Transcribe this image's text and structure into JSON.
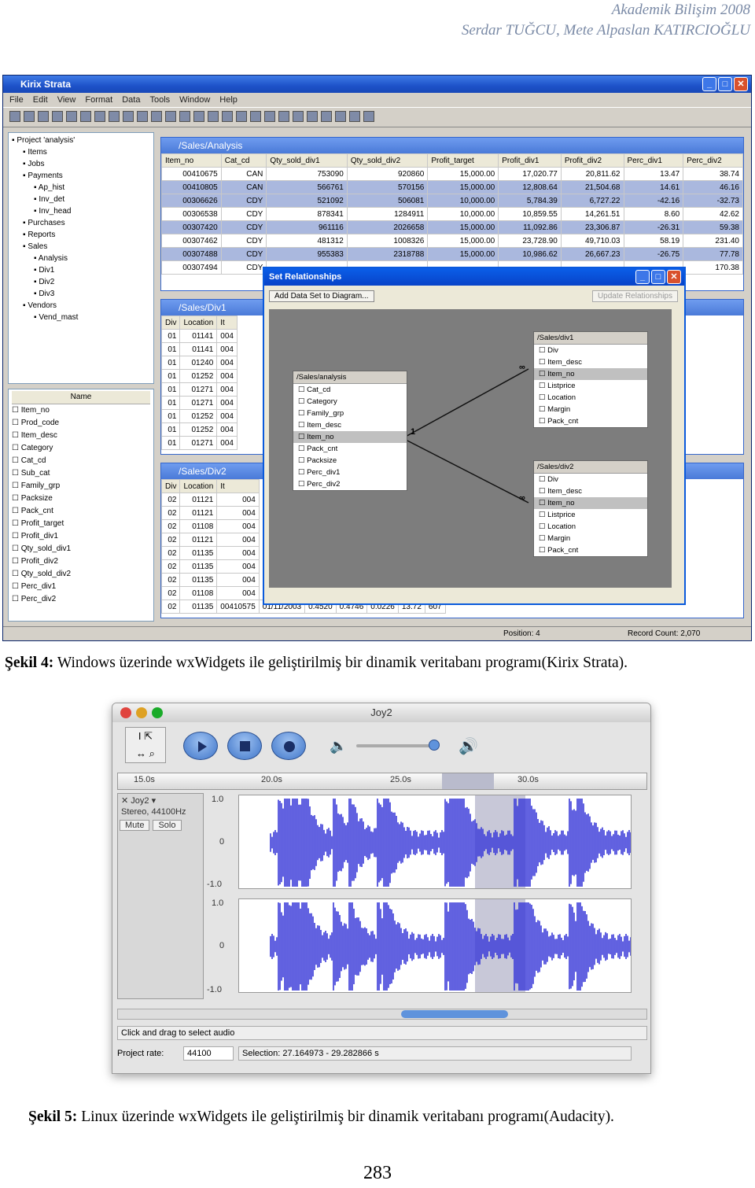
{
  "header": {
    "line1": "Akademik Bilişim 2008",
    "line2": "Serdar TUĞCU, Mete Alpaslan KATIRCIOĞLU"
  },
  "kirix": {
    "title": "Kirix Strata",
    "menu": [
      "File",
      "Edit",
      "View",
      "Format",
      "Data",
      "Tools",
      "Window",
      "Help"
    ],
    "tree": [
      "Project 'analysis'",
      "Items",
      "Jobs",
      "Payments",
      "Ap_hist",
      "Inv_det",
      "Inv_head",
      "Purchases",
      "Reports",
      "Sales",
      "Analysis",
      "Div1",
      "Div2",
      "Div3",
      "Vendors",
      "Vend_mast"
    ],
    "fields_header": "Name",
    "fields": [
      "Item_no",
      "Prod_code",
      "Item_desc",
      "Category",
      "Cat_cd",
      "Sub_cat",
      "Family_grp",
      "Packsize",
      "Pack_cnt",
      "Profit_target",
      "Profit_div1",
      "Qty_sold_div1",
      "Profit_div2",
      "Qty_sold_div2",
      "Perc_div1",
      "Perc_div2"
    ],
    "analysis": {
      "title": "/Sales/Analysis",
      "columns": [
        "Item_no",
        "Cat_cd",
        "Qty_sold_div1",
        "Qty_sold_div2",
        "Profit_target",
        "Profit_div1",
        "Profit_div2",
        "Perc_div1",
        "Perc_div2"
      ],
      "rows": [
        [
          "00410675",
          "CAN",
          "753090",
          "920860",
          "15,000.00",
          "17,020.77",
          "20,811.62",
          "13.47",
          "38.74"
        ],
        [
          "00410805",
          "CAN",
          "566761",
          "570156",
          "15,000.00",
          "12,808.64",
          "21,504.68",
          "14.61",
          "46.16"
        ],
        [
          "00306626",
          "CDY",
          "521092",
          "506081",
          "10,000.00",
          "5,784.39",
          "6,727.22",
          "-42.16",
          "-32.73"
        ],
        [
          "00306538",
          "CDY",
          "878341",
          "1284911",
          "10,000.00",
          "10,859.55",
          "14,261.51",
          "8.60",
          "42.62"
        ],
        [
          "00307420",
          "CDY",
          "961116",
          "2026658",
          "15,000.00",
          "11,092.86",
          "23,306.87",
          "-26.31",
          "59.38"
        ],
        [
          "00307462",
          "CDY",
          "481312",
          "1008326",
          "15,000.00",
          "23,728.90",
          "49,710.03",
          "58.19",
          "231.40"
        ],
        [
          "00307488",
          "CDY",
          "955383",
          "2318788",
          "15,000.00",
          "10,986.62",
          "26,667.23",
          "-26.75",
          "77.78"
        ],
        [
          "00307494",
          "CDY",
          "",
          "",
          "",
          "",
          "",
          "",
          "170.38"
        ]
      ]
    },
    "div1": {
      "title": "/Sales/Div1",
      "columns": [
        "Div",
        "Location",
        "It"
      ],
      "rows": [
        [
          "01",
          "01141",
          "004"
        ],
        [
          "01",
          "01141",
          "004"
        ],
        [
          "01",
          "01240",
          "004"
        ],
        [
          "01",
          "01252",
          "004"
        ],
        [
          "01",
          "01271",
          "004"
        ],
        [
          "01",
          "01271",
          "004"
        ],
        [
          "01",
          "01252",
          "004"
        ],
        [
          "01",
          "01252",
          "004"
        ],
        [
          "01",
          "01271",
          "004"
        ]
      ]
    },
    "div2": {
      "title": "/Sales/Div2",
      "columns": [
        "Div",
        "Location",
        "It"
      ],
      "rows": [
        [
          "02",
          "01121",
          "004"
        ],
        [
          "02",
          "01121",
          "004"
        ],
        [
          "02",
          "01108",
          "004"
        ],
        [
          "02",
          "01121",
          "004"
        ],
        [
          "02",
          "01135",
          "004"
        ],
        [
          "02",
          "01135",
          "004"
        ],
        [
          "02",
          "01135",
          "004"
        ],
        [
          "02",
          "01108",
          "004"
        ],
        [
          "02",
          "01135",
          "00410575"
        ]
      ],
      "last_row_extra": [
        "01/11/2003",
        "0.4520",
        "0.4746",
        "0.0226",
        "13.72",
        "607"
      ]
    },
    "dialog": {
      "title": "Set Relationships",
      "add_button": "Add Data Set to Diagram...",
      "update_button": "Update Relationships",
      "box_analysis": {
        "title": "/Sales/analysis",
        "items": [
          "Cat_cd",
          "Category",
          "Family_grp",
          "Item_desc",
          "Item_no",
          "Pack_cnt",
          "Packsize",
          "Perc_div1",
          "Perc_div2"
        ]
      },
      "box_div1": {
        "title": "/Sales/div1",
        "items": [
          "Div",
          "Item_desc",
          "Item_no",
          "Listprice",
          "Location",
          "Margin",
          "Pack_cnt"
        ]
      },
      "box_div2": {
        "title": "/Sales/div2",
        "items": [
          "Div",
          "Item_desc",
          "Item_no",
          "Listprice",
          "Location",
          "Margin",
          "Pack_cnt"
        ]
      },
      "one": "1",
      "many": "∞"
    },
    "status": {
      "position": "Position: 4",
      "record_count": "Record Count: 2,070"
    }
  },
  "caption4": {
    "label": "Şekil 4:",
    "text": " Windows üzerinde wxWidgets ile geliştirilmiş bir dinamik veritabanı programı(Kirix Strata)."
  },
  "audacity": {
    "title": "Joy2",
    "ruler": [
      "15.0s",
      "20.0s",
      "25.0s",
      "30.0s"
    ],
    "track_name": "Joy2",
    "track_info": "Stereo, 44100Hz",
    "mute": "Mute",
    "solo": "Solo",
    "scale": [
      "1.0",
      "0",
      "-1.0"
    ],
    "status_hint": "Click and drag to select audio",
    "project_rate_label": "Project rate:",
    "project_rate": "44100",
    "selection": "Selection: 27.164973 - 29.282866 s",
    "wave_color": "#3a3ad8"
  },
  "caption5": {
    "label": "Şekil 5:",
    "text": " Linux üzerinde wxWidgets ile geliştirilmiş bir dinamik veritabanı programı(Audacity)."
  },
  "page_number": "283"
}
